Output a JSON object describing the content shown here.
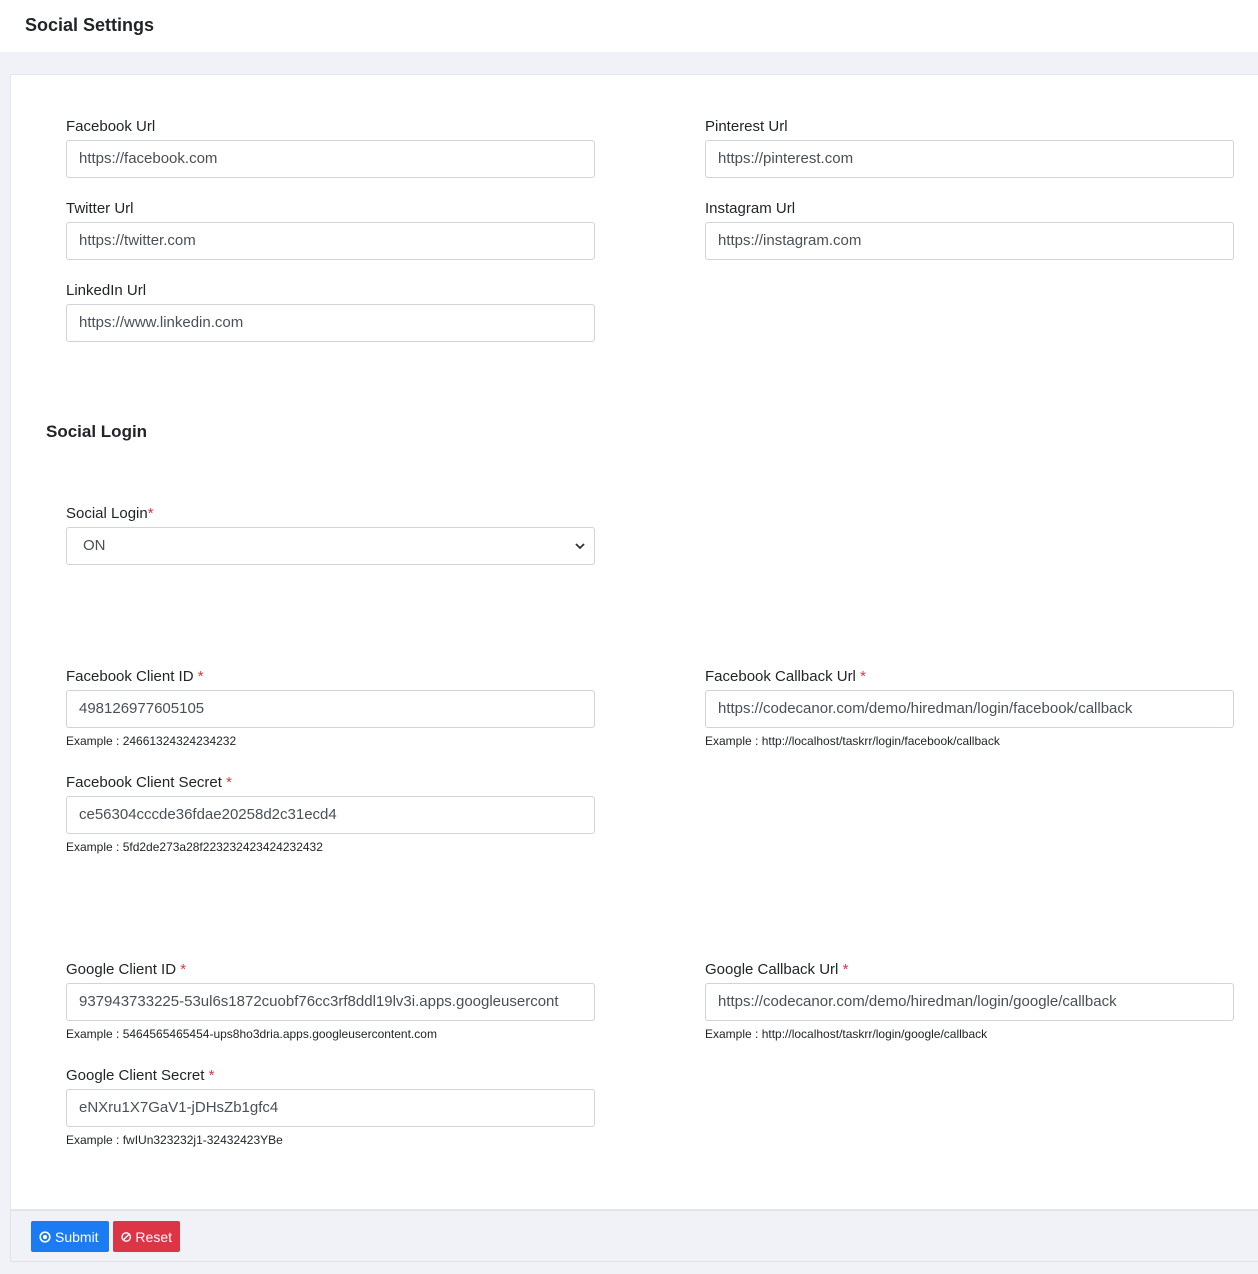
{
  "header": {
    "title": "Social Settings"
  },
  "social_links": {
    "facebook": {
      "label": "Facebook Url",
      "value": "https://facebook.com"
    },
    "pinterest": {
      "label": "Pinterest Url",
      "value": "https://pinterest.com"
    },
    "twitter": {
      "label": "Twitter Url",
      "value": "https://twitter.com"
    },
    "instagram": {
      "label": "Instagram Url",
      "value": "https://instagram.com"
    },
    "linkedin": {
      "label": "LinkedIn Url",
      "value": "https://www.linkedin.com"
    }
  },
  "social_login": {
    "section_title": "Social Login",
    "toggle": {
      "label": "Social Login",
      "value": "ON"
    },
    "required_mark": "*"
  },
  "facebook_login": {
    "client_id": {
      "label": "Facebook Client ID",
      "value": "498126977605105",
      "hint": "Example : 24661324324234232"
    },
    "callback": {
      "label": "Facebook Callback Url",
      "value": "https://codecanor.com/demo/hiredman/login/facebook/callback",
      "hint": "Example : http://localhost/taskrr/login/facebook/callback"
    },
    "client_secret": {
      "label": "Facebook Client Secret",
      "value": "ce56304cccde36fdae20258d2c31ecd4",
      "hint": "Example : 5fd2de273a28f223232423424232432"
    }
  },
  "google_login": {
    "client_id": {
      "label": "Google Client ID",
      "value": "937943733225-53ul6s1872cuobf76cc3rf8ddl19lv3i.apps.googleusercont",
      "hint": "Example : 5464565465454-ups8ho3dria.apps.googleusercontent.com"
    },
    "callback": {
      "label": "Google Callback Url",
      "value": "https://codecanor.com/demo/hiredman/login/google/callback",
      "hint": "Example : http://localhost/taskrr/login/google/callback"
    },
    "client_secret": {
      "label": "Google Client Secret",
      "value": "eNXru1X7GaV1-jDHsZb1gfc4",
      "hint": "Example : fwIUn323232j1-32432423YBe"
    }
  },
  "actions": {
    "submit_label": "Submit",
    "reset_label": "Reset"
  },
  "colors": {
    "primary": "#1a7bf2",
    "danger": "#dc3545",
    "background": "#f0f2f7"
  },
  "icons": {
    "submit": "circle-dot-icon",
    "reset": "ban-icon",
    "select": "chevron-down-icon"
  }
}
